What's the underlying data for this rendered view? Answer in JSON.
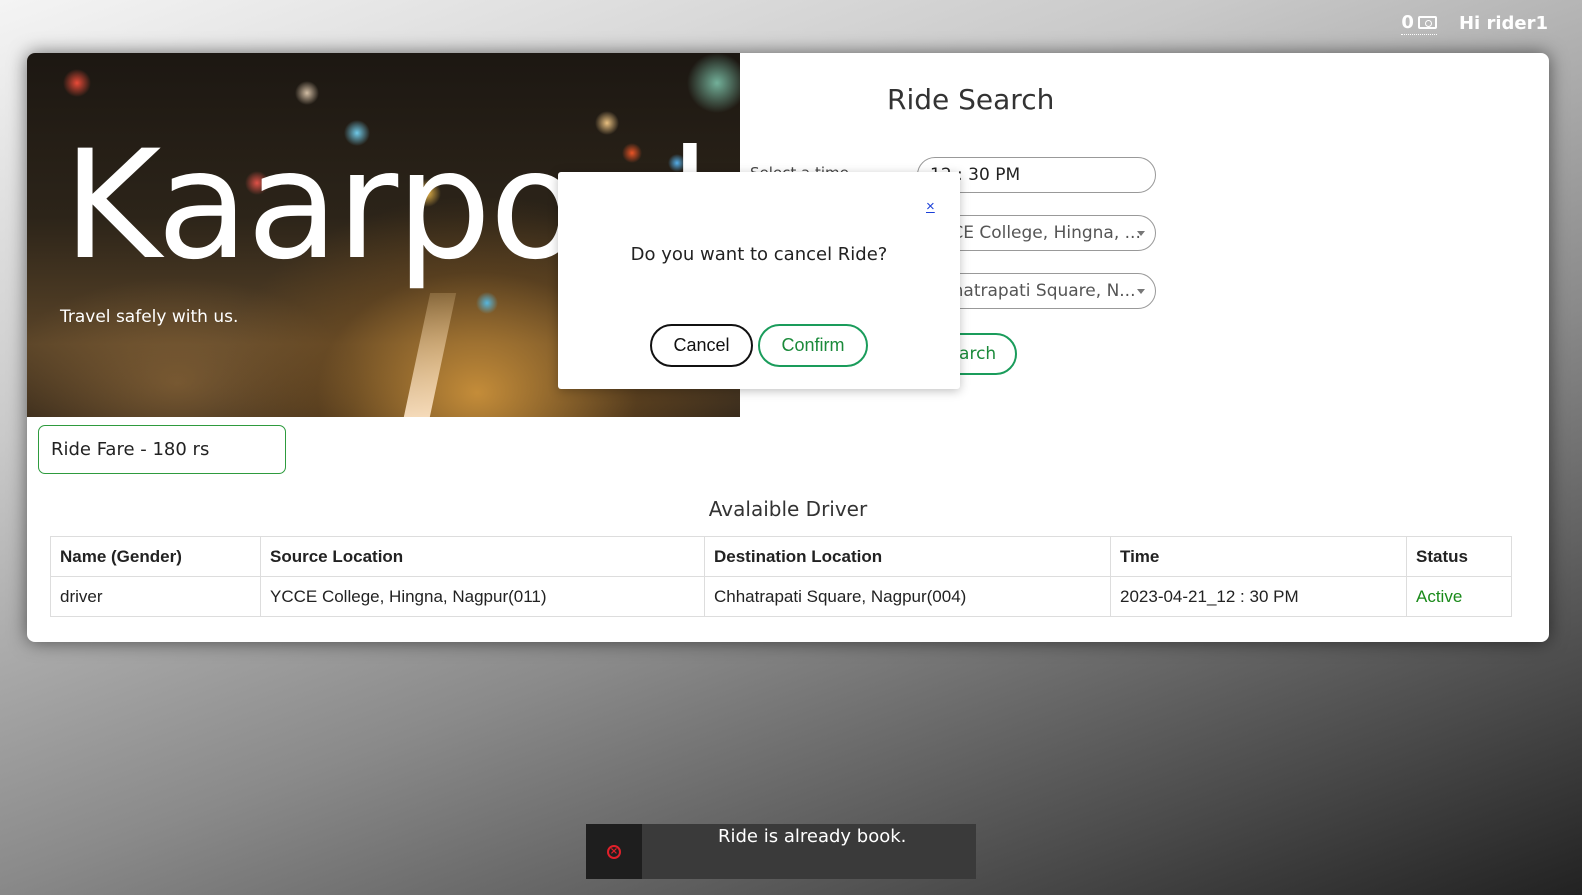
{
  "header": {
    "wallet_balance": "0",
    "greeting": "Hi rider1"
  },
  "hero": {
    "brand": "Kaarpool",
    "tagline": "Travel safely with us."
  },
  "search": {
    "title": "Ride Search",
    "time_label": "Select a time",
    "time_value": "12 : 30 PM",
    "source_value": "YCCE College, Hingna, ...",
    "destination_value": "Chhatrapati Square, N...",
    "search_button": "Search"
  },
  "fare": {
    "label": "Ride Fare - 180 rs"
  },
  "drivers": {
    "title": "Avalaible Driver",
    "columns": [
      "Name (Gender)",
      "Source Location",
      "Destination Location",
      "Time",
      "Status"
    ],
    "rows": [
      [
        "driver",
        "YCCE College, Hingna, Nagpur(011)",
        "Chhatrapati Square, Nagpur(004)",
        "2023-04-21_12 : 30 PM",
        "Active"
      ]
    ]
  },
  "modal": {
    "close": "×",
    "message": "Do you want to cancel Ride?",
    "cancel_button": "Cancel",
    "confirm_button": "Confirm"
  },
  "toast": {
    "message": "Ride is already book.",
    "icon": "error-circle-icon"
  },
  "colors": {
    "accent_green": "#1a9c5b",
    "status_active": "#1a8a1a",
    "toast_bg": "#3a3a3a",
    "error_red": "#e0202a"
  }
}
